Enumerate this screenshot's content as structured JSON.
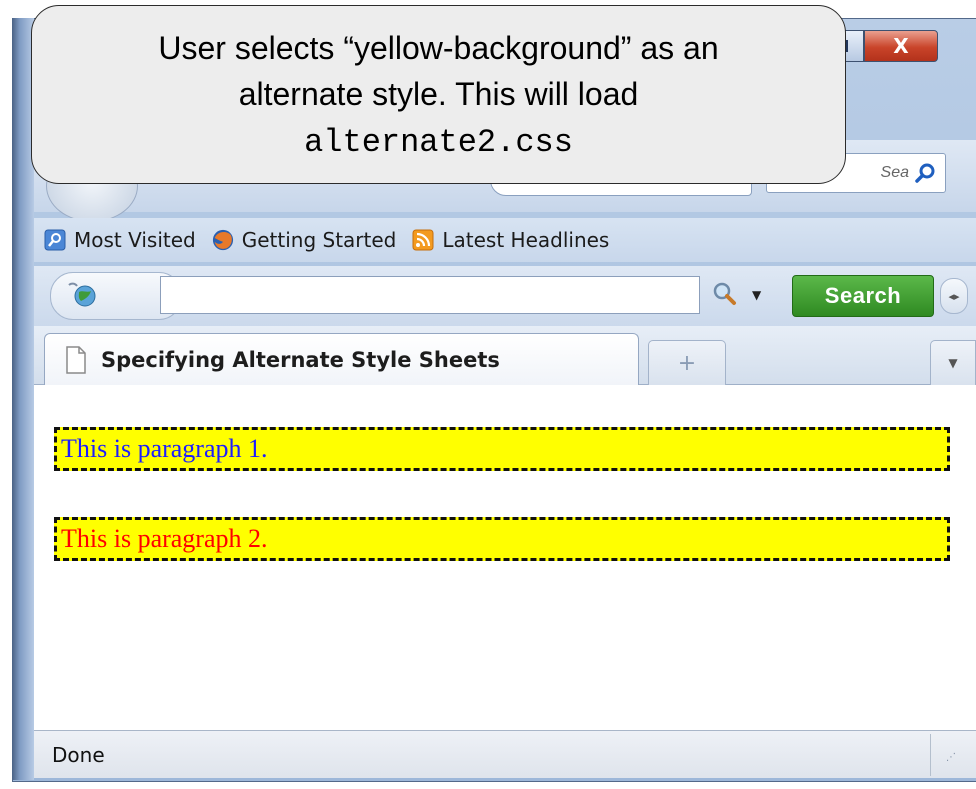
{
  "callout": {
    "line1": "User selects “yellow-background” as an",
    "line2": "alternate style.  This will load",
    "line3": "alternate2.css"
  },
  "window": {
    "close_glyph": "X"
  },
  "navbar": {
    "search_placeholder": "Sea"
  },
  "bookmarks": [
    {
      "label": "Most Visited",
      "icon": "most-visited-icon"
    },
    {
      "label": "Getting Started",
      "icon": "firefox-icon"
    },
    {
      "label": "Latest Headlines",
      "icon": "rss-icon"
    }
  ],
  "search_toolbar": {
    "button_label": "Search",
    "input_value": ""
  },
  "tabs": [
    {
      "label": "Specifying Alternate Style Sheets",
      "active": true
    }
  ],
  "content": {
    "paragraphs": [
      {
        "text": "This is paragraph 1.",
        "color": "#1d1dff"
      },
      {
        "text": "This is paragraph 2.",
        "color": "#ff0000"
      }
    ],
    "paragraph_background": "#ffff00"
  },
  "status": {
    "text": "Done"
  }
}
